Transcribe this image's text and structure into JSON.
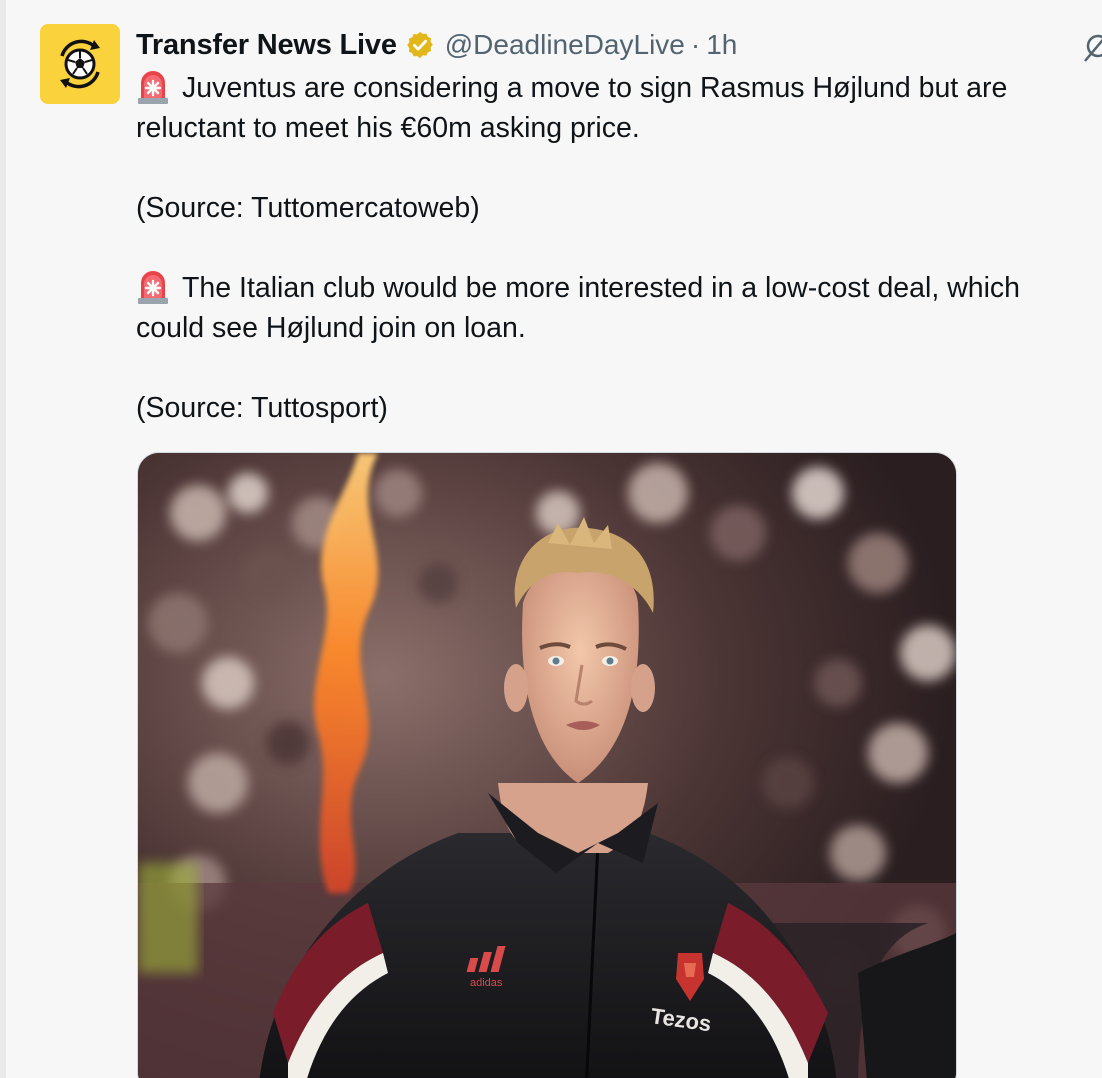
{
  "tweet": {
    "author": {
      "display_name": "Transfer News Live",
      "handle": "@DeadlineDayLive",
      "verified": true,
      "avatar_icon": "soccer-ball-transfer-arrows-icon",
      "avatar_color": "#f9d23c"
    },
    "separator": "·",
    "time": "1h",
    "body": {
      "line1": "Juventus are considering a move to sign Rasmus Højlund but are",
      "line2": "reluctant to meet his €60m asking price.",
      "source1": "(Source: Tuttomercatoweb)",
      "line3": "The Italian club would be more interested in a low-cost deal, which",
      "line4": "could see Højlund join on loan.",
      "source2": "(Source: Tuttosport)"
    },
    "emoji_icon": "rotating-siren-icon",
    "media": {
      "type": "photo",
      "shirt_brand_text": "adidas",
      "shirt_sponsor_text": "Tezos"
    }
  },
  "colors": {
    "text": "#0f1419",
    "secondary_text": "#536471",
    "verified_gold": "#e2b719",
    "background": "#f7f7f7"
  }
}
